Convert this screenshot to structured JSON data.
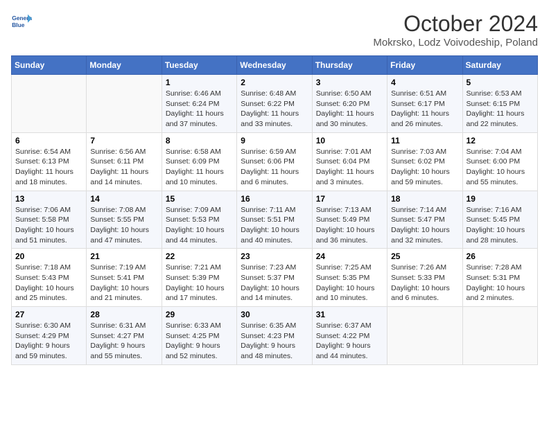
{
  "header": {
    "logo_line1": "General",
    "logo_line2": "Blue",
    "title": "October 2024",
    "subtitle": "Mokrsko, Lodz Voivodeship, Poland"
  },
  "days_of_week": [
    "Sunday",
    "Monday",
    "Tuesday",
    "Wednesday",
    "Thursday",
    "Friday",
    "Saturday"
  ],
  "weeks": [
    [
      {
        "num": "",
        "detail": ""
      },
      {
        "num": "",
        "detail": ""
      },
      {
        "num": "1",
        "detail": "Sunrise: 6:46 AM\nSunset: 6:24 PM\nDaylight: 11 hours and 37 minutes."
      },
      {
        "num": "2",
        "detail": "Sunrise: 6:48 AM\nSunset: 6:22 PM\nDaylight: 11 hours and 33 minutes."
      },
      {
        "num": "3",
        "detail": "Sunrise: 6:50 AM\nSunset: 6:20 PM\nDaylight: 11 hours and 30 minutes."
      },
      {
        "num": "4",
        "detail": "Sunrise: 6:51 AM\nSunset: 6:17 PM\nDaylight: 11 hours and 26 minutes."
      },
      {
        "num": "5",
        "detail": "Sunrise: 6:53 AM\nSunset: 6:15 PM\nDaylight: 11 hours and 22 minutes."
      }
    ],
    [
      {
        "num": "6",
        "detail": "Sunrise: 6:54 AM\nSunset: 6:13 PM\nDaylight: 11 hours and 18 minutes."
      },
      {
        "num": "7",
        "detail": "Sunrise: 6:56 AM\nSunset: 6:11 PM\nDaylight: 11 hours and 14 minutes."
      },
      {
        "num": "8",
        "detail": "Sunrise: 6:58 AM\nSunset: 6:09 PM\nDaylight: 11 hours and 10 minutes."
      },
      {
        "num": "9",
        "detail": "Sunrise: 6:59 AM\nSunset: 6:06 PM\nDaylight: 11 hours and 6 minutes."
      },
      {
        "num": "10",
        "detail": "Sunrise: 7:01 AM\nSunset: 6:04 PM\nDaylight: 11 hours and 3 minutes."
      },
      {
        "num": "11",
        "detail": "Sunrise: 7:03 AM\nSunset: 6:02 PM\nDaylight: 10 hours and 59 minutes."
      },
      {
        "num": "12",
        "detail": "Sunrise: 7:04 AM\nSunset: 6:00 PM\nDaylight: 10 hours and 55 minutes."
      }
    ],
    [
      {
        "num": "13",
        "detail": "Sunrise: 7:06 AM\nSunset: 5:58 PM\nDaylight: 10 hours and 51 minutes."
      },
      {
        "num": "14",
        "detail": "Sunrise: 7:08 AM\nSunset: 5:55 PM\nDaylight: 10 hours and 47 minutes."
      },
      {
        "num": "15",
        "detail": "Sunrise: 7:09 AM\nSunset: 5:53 PM\nDaylight: 10 hours and 44 minutes."
      },
      {
        "num": "16",
        "detail": "Sunrise: 7:11 AM\nSunset: 5:51 PM\nDaylight: 10 hours and 40 minutes."
      },
      {
        "num": "17",
        "detail": "Sunrise: 7:13 AM\nSunset: 5:49 PM\nDaylight: 10 hours and 36 minutes."
      },
      {
        "num": "18",
        "detail": "Sunrise: 7:14 AM\nSunset: 5:47 PM\nDaylight: 10 hours and 32 minutes."
      },
      {
        "num": "19",
        "detail": "Sunrise: 7:16 AM\nSunset: 5:45 PM\nDaylight: 10 hours and 28 minutes."
      }
    ],
    [
      {
        "num": "20",
        "detail": "Sunrise: 7:18 AM\nSunset: 5:43 PM\nDaylight: 10 hours and 25 minutes."
      },
      {
        "num": "21",
        "detail": "Sunrise: 7:19 AM\nSunset: 5:41 PM\nDaylight: 10 hours and 21 minutes."
      },
      {
        "num": "22",
        "detail": "Sunrise: 7:21 AM\nSunset: 5:39 PM\nDaylight: 10 hours and 17 minutes."
      },
      {
        "num": "23",
        "detail": "Sunrise: 7:23 AM\nSunset: 5:37 PM\nDaylight: 10 hours and 14 minutes."
      },
      {
        "num": "24",
        "detail": "Sunrise: 7:25 AM\nSunset: 5:35 PM\nDaylight: 10 hours and 10 minutes."
      },
      {
        "num": "25",
        "detail": "Sunrise: 7:26 AM\nSunset: 5:33 PM\nDaylight: 10 hours and 6 minutes."
      },
      {
        "num": "26",
        "detail": "Sunrise: 7:28 AM\nSunset: 5:31 PM\nDaylight: 10 hours and 2 minutes."
      }
    ],
    [
      {
        "num": "27",
        "detail": "Sunrise: 6:30 AM\nSunset: 4:29 PM\nDaylight: 9 hours and 59 minutes."
      },
      {
        "num": "28",
        "detail": "Sunrise: 6:31 AM\nSunset: 4:27 PM\nDaylight: 9 hours and 55 minutes."
      },
      {
        "num": "29",
        "detail": "Sunrise: 6:33 AM\nSunset: 4:25 PM\nDaylight: 9 hours and 52 minutes."
      },
      {
        "num": "30",
        "detail": "Sunrise: 6:35 AM\nSunset: 4:23 PM\nDaylight: 9 hours and 48 minutes."
      },
      {
        "num": "31",
        "detail": "Sunrise: 6:37 AM\nSunset: 4:22 PM\nDaylight: 9 hours and 44 minutes."
      },
      {
        "num": "",
        "detail": ""
      },
      {
        "num": "",
        "detail": ""
      }
    ]
  ]
}
